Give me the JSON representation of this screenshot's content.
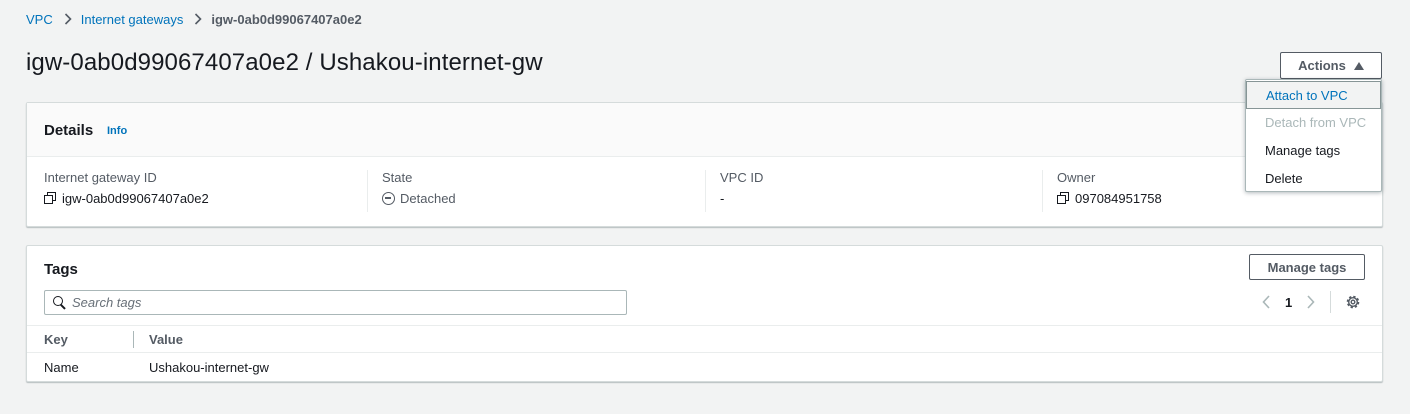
{
  "breadcrumb": {
    "items": [
      "VPC",
      "Internet gateways"
    ],
    "current": "igw-0ab0d99067407a0e2"
  },
  "page": {
    "title": "igw-0ab0d99067407a0e2 / Ushakou-internet-gw"
  },
  "actions": {
    "label": "Actions",
    "menu": [
      {
        "label": "Attach to VPC",
        "state": "highlighted"
      },
      {
        "label": "Detach from VPC",
        "state": "disabled"
      },
      {
        "label": "Manage tags",
        "state": "normal"
      },
      {
        "label": "Delete",
        "state": "normal"
      }
    ]
  },
  "details": {
    "title": "Details",
    "info_label": "Info",
    "fields": [
      {
        "label": "Internet gateway ID",
        "value": "igw-0ab0d99067407a0e2",
        "icon": "copy-icon"
      },
      {
        "label": "State",
        "value": "Detached",
        "icon": "status-detached-icon"
      },
      {
        "label": "VPC ID",
        "value": "-"
      },
      {
        "label": "Owner",
        "value": "097084951758",
        "icon": "copy-icon"
      }
    ]
  },
  "tags": {
    "title": "Tags",
    "manage_label": "Manage tags",
    "search_placeholder": "Search tags",
    "page_number": "1",
    "columns": [
      "Key",
      "Value"
    ],
    "rows": [
      {
        "key": "Name",
        "value": "Ushakou-internet-gw"
      }
    ]
  },
  "colors": {
    "link": "#0073bb",
    "highlight": "#ffff66",
    "background": "#f2f3f3"
  }
}
